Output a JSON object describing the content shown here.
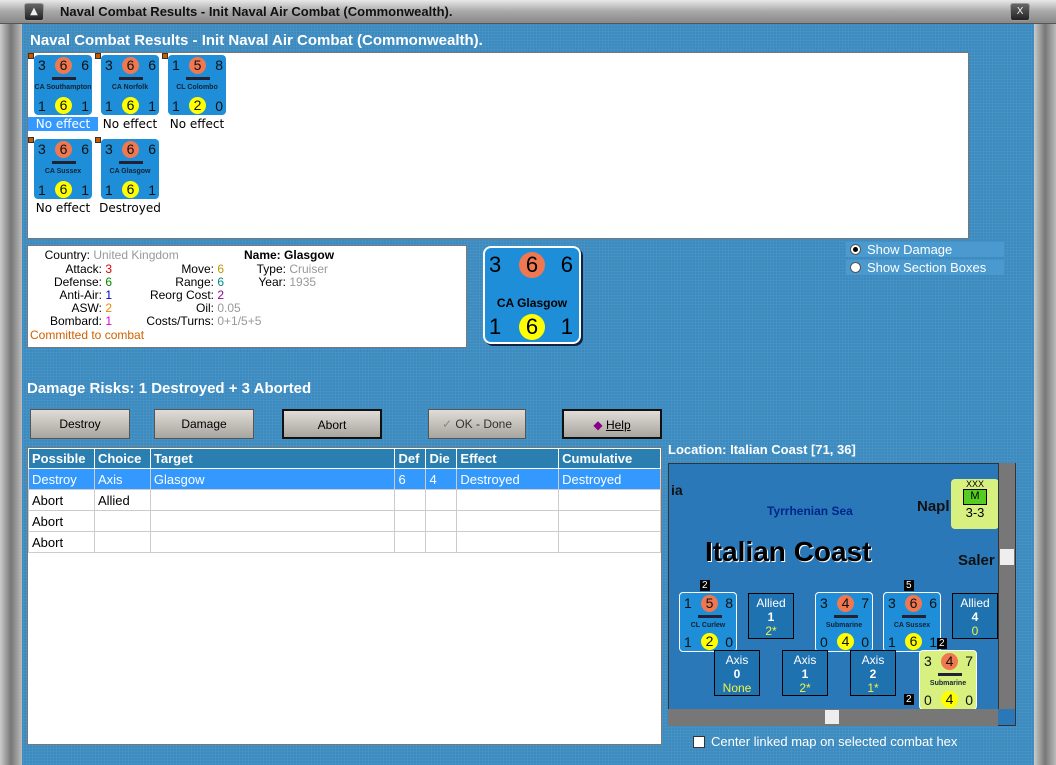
{
  "window": {
    "title": "Naval Combat Results - Init Naval Air Combat (Commonwealth)."
  },
  "heading": "Naval Combat Results - Init Naval Air Combat (Commonwealth).",
  "counters": [
    {
      "tl": "3",
      "att": "6",
      "tr": "6",
      "name": "CA Southampton",
      "bl": "1",
      "def": "6",
      "br": "1",
      "result": "No effect",
      "selected": true
    },
    {
      "tl": "3",
      "att": "6",
      "tr": "6",
      "name": "CA Norfolk",
      "bl": "1",
      "def": "6",
      "br": "1",
      "result": "No effect"
    },
    {
      "tl": "1",
      "att": "5",
      "tr": "8",
      "name": "CL Colombo",
      "bl": "1",
      "def": "2",
      "br": "0",
      "result": "No effect"
    },
    {
      "tl": "3",
      "att": "6",
      "tr": "6",
      "name": "CA Sussex",
      "bl": "1",
      "def": "6",
      "br": "1",
      "result": "No effect"
    },
    {
      "tl": "3",
      "att": "6",
      "tr": "6",
      "name": "CA Glasgow",
      "bl": "1",
      "def": "6",
      "br": "1",
      "result": "Destroyed"
    }
  ],
  "info": {
    "country_label": "Country:",
    "country": "United Kingdom",
    "attack_label": "Attack:",
    "attack": "3",
    "defense_label": "Defense:",
    "defense": "6",
    "antiair_label": "Anti-Air:",
    "antiair": "1",
    "asw_label": "ASW:",
    "asw": "2",
    "bombard_label": "Bombard:",
    "bombard": "1",
    "move_label": "Move:",
    "move": "6",
    "range_label": "Range:",
    "range": "6",
    "reorg_label": "Reorg Cost:",
    "reorg": "2",
    "oil_label": "Oil:",
    "oil": "0.05",
    "costs_label": "Costs/Turns:",
    "costs": "0+1/5+5",
    "name_label": "Name:",
    "name": "Glasgow",
    "type_label": "Type:",
    "type": "Cruiser",
    "year_label": "Year:",
    "year": "1935",
    "status": "Committed to combat"
  },
  "big_counter": {
    "tl": "3",
    "att": "6",
    "tr": "6",
    "name": "CA Glasgow",
    "bl": "1",
    "def": "6",
    "br": "1"
  },
  "options": {
    "show_damage": "Show Damage",
    "show_section_boxes": "Show Section Boxes",
    "selected": "show_damage"
  },
  "risks": "Damage Risks: 1 Destroyed + 3 Aborted",
  "buttons": {
    "destroy": "Destroy",
    "damage": "Damage",
    "abort": "Abort",
    "ok": "OK - Done",
    "help": "Help"
  },
  "table": {
    "headers": [
      "Possible",
      "Choice",
      "Target",
      "Def",
      "Die",
      "Effect",
      "Cumulative"
    ],
    "rows": [
      [
        "Destroy",
        "Axis",
        "Glasgow",
        "6",
        "4",
        "Destroyed",
        "Destroyed"
      ],
      [
        "Abort",
        "Allied",
        "",
        "",
        "",
        "",
        ""
      ],
      [
        "Abort",
        "",
        "",
        "",
        "",
        "",
        ""
      ],
      [
        "Abort",
        "",
        "",
        "",
        "",
        "",
        ""
      ]
    ]
  },
  "location": "Location:  Italian Coast [71, 36]",
  "map": {
    "sea": "Tyrrhenian Sea",
    "area": "Italian Coast",
    "ia": "ia",
    "napl": "Napl",
    "saler": "Saler",
    "unit": {
      "top": "XXX",
      "sym": "M",
      "val": "3-3"
    },
    "stacks": [
      "2",
      "5",
      "2",
      "2"
    ],
    "ships": [
      {
        "tl": "1",
        "att": "5",
        "tr": "8",
        "name": "CL Curlew",
        "bl": "1",
        "def": "2",
        "br": "0"
      },
      {
        "tl": "3",
        "att": "4",
        "tr": "7",
        "name": "Submarine",
        "bl": "0",
        "def": "4",
        "br": "0"
      },
      {
        "tl": "3",
        "att": "6",
        "tr": "6",
        "name": "CA Sussex",
        "bl": "1",
        "def": "6",
        "br": "1"
      },
      {
        "tl": "3",
        "att": "4",
        "tr": "7",
        "name": "Submarine",
        "bl": "0",
        "def": "4",
        "br": "0"
      }
    ],
    "boxes": [
      {
        "side": "Allied",
        "n": "1",
        "v": "2*"
      },
      {
        "side": "Allied",
        "n": "4",
        "v": "0"
      },
      {
        "side": "Axis",
        "n": "0",
        "v": "None"
      },
      {
        "side": "Axis",
        "n": "1",
        "v": "2*"
      },
      {
        "side": "Axis",
        "n": "2",
        "v": "1*"
      }
    ]
  },
  "center_linked": "Center linked map on selected combat hex",
  "colors": {
    "attack_circle": "#f07850",
    "defense_circle": "#ffff00",
    "counter_blue": "#1f8ed8",
    "axis_counter": "#d8f080",
    "selection": "#3399ff"
  }
}
